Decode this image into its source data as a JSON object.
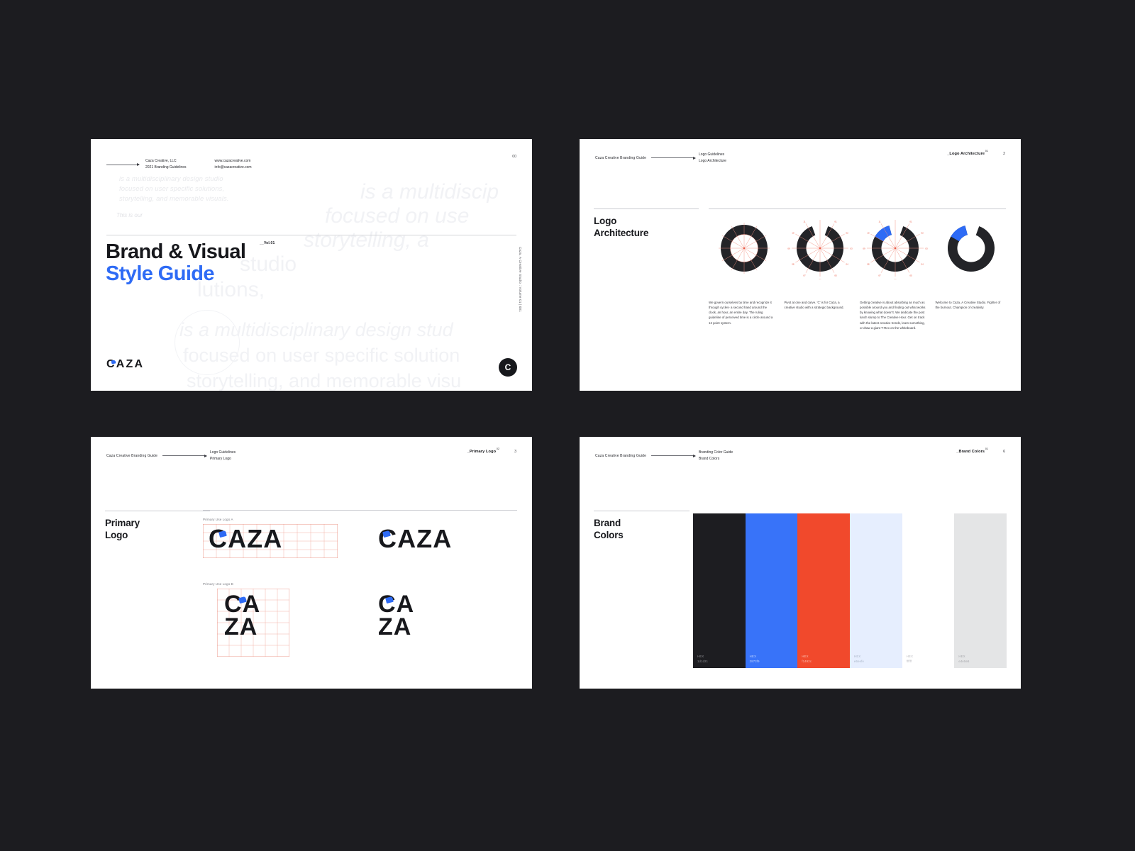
{
  "brand": {
    "name": "CAZA",
    "accent_blue": "#2e6bf5",
    "ink": "#17181c",
    "guide_label": "Caza Creative Branding Guide"
  },
  "slide1": {
    "meta_company": "Caza Creative, LLC",
    "meta_year": "2021 Branding Guidelines",
    "meta_web": "www.cazacreative.com",
    "meta_email": "info@cazacreative.com",
    "page": "00",
    "ghost_paragraph": "is a multidisciplinary design studio\nfocused on user specific solutions,\nstorytelling, and memorable visuals.",
    "ghost_thisis": "This is our",
    "ghost_big": [
      "is a multidiscip",
      "focused on use",
      "storytelling, a",
      "studio",
      "lutions,",
      "is a multidisciplinary design stud",
      "focused on user specific solution",
      "storytelling, and memorable visu"
    ],
    "title_line1": "Brand & Visual",
    "title_line2": "Style Guide",
    "volume": "__Vol.01",
    "vertical_note": "Caza, A Creative Studio : Volume 01 | 001",
    "wordmark": "CAZA",
    "badge": "C"
  },
  "slide2": {
    "header_brand": "Caza Creative Branding Guide",
    "header_sub1": "Logo Guidelines",
    "header_sub2": "Logo Architecture",
    "chapter": "_Logo Architecture",
    "chapter_sup": "01",
    "page": "2",
    "title": "Logo\nArchitecture",
    "marks": [
      {
        "name": "ring-full",
        "gap_start": 0,
        "gap_end": 0,
        "blue_start": 0,
        "blue_end": 0,
        "caption": "We govern ourselves by time and recognize it through cycles- a second hand around the clock, an hour, an entire day. The ruling guideline of perceived time is a  circle around a 12 point system."
      },
      {
        "name": "c-open",
        "gap_start": 340,
        "gap_end": 20,
        "blue_start": 0,
        "blue_end": 0,
        "caption": "Pivot at one and carve. 'C' is for Caza, a creative studio with a strategic background."
      },
      {
        "name": "c-blue-accent-grid",
        "gap_start": 345,
        "gap_end": 20,
        "blue_start": 300,
        "blue_end": 345,
        "caption": "Getting creative is about absorbing as much as possible around you and finding out what works by knowing what doesn't. We dedicate the post lunch slump to The Creative Hour. Get on track with the latest creative trends, learn something, or draw a giant T-Rex on the whiteboard."
      },
      {
        "name": "c-final",
        "gap_start": 345,
        "gap_end": 20,
        "blue_start": 300,
        "blue_end": 345,
        "caption": "Welcome to Caza, A Creative Studio. Fighter of the burnout. Champion of creativity."
      }
    ],
    "clock_ticks": [
      "12",
      "01",
      "02",
      "03",
      "04",
      "05",
      "06",
      "07",
      "08",
      "09",
      "10",
      "11"
    ]
  },
  "slide3": {
    "header_brand": "Caza Creative Branding Guide",
    "header_sub1": "Logo Guidelines",
    "header_sub2": "Primary Logo",
    "chapter": "_Primary Logo",
    "chapter_sup": "02",
    "page": "3",
    "title": "Primary\nLogo",
    "label_a": "Primary Use Logo A",
    "label_b": "Primary Use Logo B",
    "wordmark": "CAZA",
    "wordmark_stack_1": "CA",
    "wordmark_stack_2": "ZA"
  },
  "slide4": {
    "header_brand": "Caza Creative Branding Guide",
    "header_sub1": "Branding Color Guide",
    "header_sub2": "Brand Colors",
    "chapter": "_Brand Colors",
    "chapter_sup": "01",
    "page": "6",
    "title": "Brand\nColors",
    "hex_key": "HEX",
    "swatches": [
      {
        "name": "ink",
        "hex": "1d1d21",
        "css": "#1d1d21",
        "text": "#8c8d92"
      },
      {
        "name": "blue",
        "hex": "3873f9",
        "css": "#3873f9",
        "text": "#c3d6fd"
      },
      {
        "name": "red",
        "hex": "f1492c",
        "css": "#f1492c",
        "text": "#fbc3b6"
      },
      {
        "name": "pale-blue",
        "hex": "e6eefe",
        "css": "#e6eefe",
        "text": "#a8b4c6"
      },
      {
        "name": "white",
        "hex": "ffffff",
        "css": "#ffffff",
        "text": "#b6b7bc"
      },
      {
        "name": "light-gray",
        "hex": "e4e5e6",
        "css": "#e4e5e6",
        "text": "#a6a7ab"
      }
    ]
  }
}
